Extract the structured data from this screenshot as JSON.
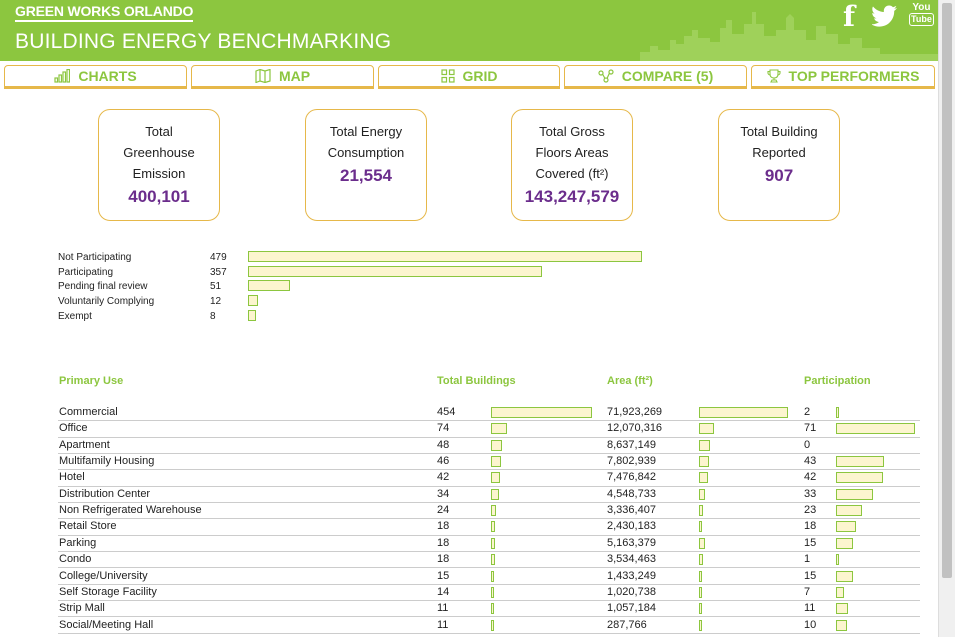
{
  "header": {
    "brand": "GREEN WORKS ORLANDO",
    "subtitle": "BUILDING ENERGY BENCHMARKING",
    "social": {
      "facebook": "f",
      "youtube_top": "You",
      "youtube_bottom": "Tube"
    }
  },
  "tabs": [
    {
      "label": "CHARTS",
      "icon": "bar-chart-icon"
    },
    {
      "label": "MAP",
      "icon": "map-icon"
    },
    {
      "label": "GRID",
      "icon": "grid-icon"
    },
    {
      "label": "COMPARE (5)",
      "icon": "compare-icon"
    },
    {
      "label": "TOP PERFORMERS",
      "icon": "trophy-icon"
    }
  ],
  "stats": [
    {
      "lines": [
        "Total",
        "Greenhouse",
        "Emission"
      ],
      "value": "400,101"
    },
    {
      "lines": [
        "Total Energy",
        "Consumption"
      ],
      "value": "21,554"
    },
    {
      "lines": [
        "Total Gross",
        "Floors Areas",
        "Covered (ft²)"
      ],
      "value": "143,247,579"
    },
    {
      "lines": [
        "Total Building",
        "Reported"
      ],
      "value": "907"
    }
  ],
  "status": [
    {
      "label": "Not Participating",
      "count": 479
    },
    {
      "label": "Participating",
      "count": 357
    },
    {
      "label": "Pending final review",
      "count": 51
    },
    {
      "label": "Voluntarily Complying",
      "count": 12
    },
    {
      "label": "Exempt",
      "count": 8
    }
  ],
  "table": {
    "headers": {
      "use": "Primary Use",
      "buildings": "Total Buildings",
      "area": "Area (ft²)",
      "participation": "Participation"
    },
    "rows": [
      {
        "use": "Commercial",
        "buildings": 454,
        "area": "71,923,269",
        "area_num": 71923269,
        "participation": 2
      },
      {
        "use": "Office",
        "buildings": 74,
        "area": "12,070,316",
        "area_num": 12070316,
        "participation": 71
      },
      {
        "use": "Apartment",
        "buildings": 48,
        "area": "8,637,149",
        "area_num": 8637149,
        "participation": 0
      },
      {
        "use": "Multifamily Housing",
        "buildings": 46,
        "area": "7,802,939",
        "area_num": 7802939,
        "participation": 43
      },
      {
        "use": "Hotel",
        "buildings": 42,
        "area": "7,476,842",
        "area_num": 7476842,
        "participation": 42
      },
      {
        "use": "Distribution Center",
        "buildings": 34,
        "area": "4,548,733",
        "area_num": 4548733,
        "participation": 33
      },
      {
        "use": "Non Refrigerated Warehouse",
        "buildings": 24,
        "area": "3,336,407",
        "area_num": 3336407,
        "participation": 23
      },
      {
        "use": "Retail Store",
        "buildings": 18,
        "area": "2,430,183",
        "area_num": 2430183,
        "participation": 18
      },
      {
        "use": "Parking",
        "buildings": 18,
        "area": "5,163,379",
        "area_num": 5163379,
        "participation": 15
      },
      {
        "use": "Condo",
        "buildings": 18,
        "area": "3,534,463",
        "area_num": 3534463,
        "participation": 1
      },
      {
        "use": "College/University",
        "buildings": 15,
        "area": "1,433,249",
        "area_num": 1433249,
        "participation": 15
      },
      {
        "use": "Self Storage Facility",
        "buildings": 14,
        "area": "1,020,738",
        "area_num": 1020738,
        "participation": 7
      },
      {
        "use": "Strip Mall",
        "buildings": 11,
        "area": "1,057,184",
        "area_num": 1057184,
        "participation": 11
      },
      {
        "use": "Social/Meeting Hall",
        "buildings": 11,
        "area": "287,766",
        "area_num": 287766,
        "participation": 10
      }
    ]
  },
  "colors": {
    "brand_green": "#8cc63f",
    "accent_gold": "#e6b84a",
    "value_purple": "#6b2d8c",
    "bar_fill": "#fcf5cf"
  }
}
